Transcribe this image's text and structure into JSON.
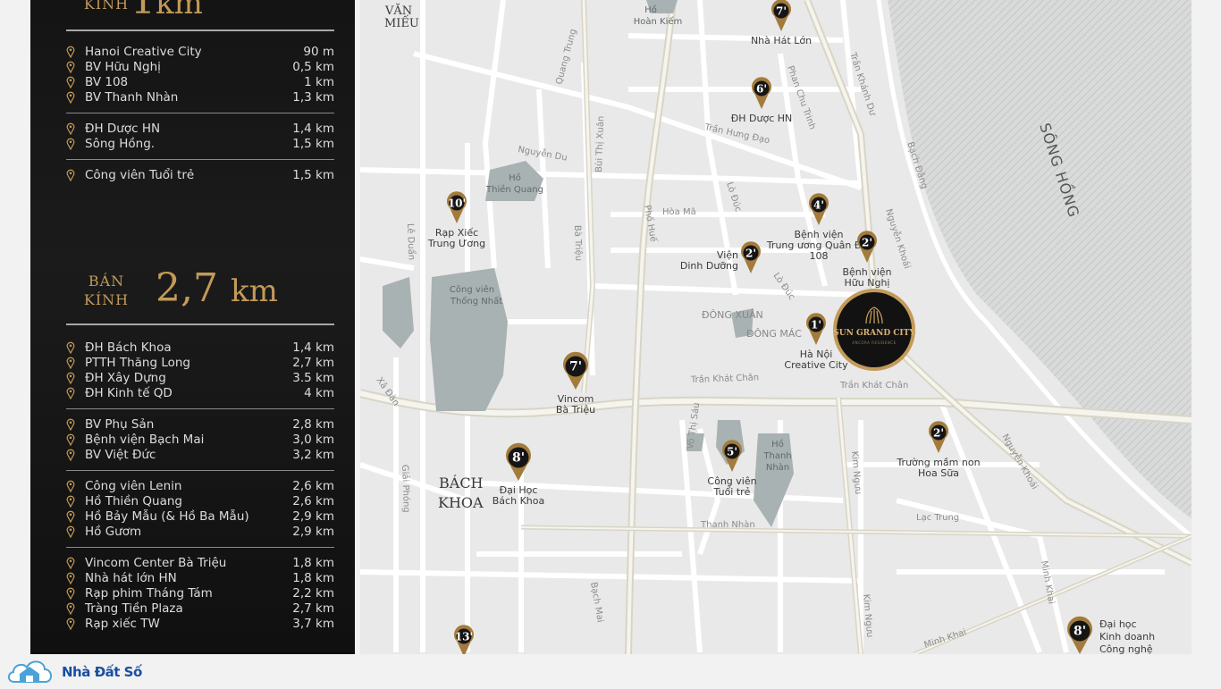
{
  "panel": {
    "top_heading": {
      "label": "KÍNH",
      "value": "1",
      "unit": "km"
    },
    "radius": {
      "line1": "BÁN",
      "line2": "KÍNH",
      "value": "2,7",
      "unit": "km"
    },
    "groups_1km": [
      [
        {
          "name": "Hanoi Creative City",
          "distance": "90 m"
        },
        {
          "name": "BV Hữu Nghị",
          "distance": "0,5 km"
        },
        {
          "name": "BV 108",
          "distance": "1 km"
        },
        {
          "name": "BV Thanh Nhàn",
          "distance": "1,3 km"
        }
      ],
      [
        {
          "name": "ĐH Dược HN",
          "distance": "1,4 km"
        },
        {
          "name": "Sông Hồng.",
          "distance": "1,5 km"
        }
      ],
      [
        {
          "name": "Công viên Tuổi trẻ",
          "distance": "1,5 km"
        }
      ]
    ],
    "groups_27km": [
      [
        {
          "name": "ĐH Bách Khoa",
          "distance": "1,4 km"
        },
        {
          "name": "PTTH Thăng Long",
          "distance": "2,7 km"
        },
        {
          "name": "ĐH Xây Dựng",
          "distance": "3.5 km"
        },
        {
          "name": "ĐH Kinh tế QD",
          "distance": "4 km"
        }
      ],
      [
        {
          "name": "BV Phụ Sản",
          "distance": "2,8 km"
        },
        {
          "name": "Bệnh viện Bạch Mai",
          "distance": "3,0 km"
        },
        {
          "name": "BV Việt Đức",
          "distance": "3,2 km"
        }
      ],
      [
        {
          "name": "Công viên Lenin",
          "distance": "2,6 km"
        },
        {
          "name": "Hồ Thiền Quang",
          "distance": "2,6 km"
        },
        {
          "name": "Hồ Bảy Mẫu (& Hồ Ba Mẫu)",
          "distance": "2,9 km"
        },
        {
          "name": "Hồ Gươm",
          "distance": "2,9 km"
        }
      ],
      [
        {
          "name": "Vincom Center Bà Triệu",
          "distance": "1,8 km"
        },
        {
          "name": "Nhà hát lớn HN",
          "distance": "1,8 km"
        },
        {
          "name": "Rạp phim Tháng Tám",
          "distance": "2,2 km"
        },
        {
          "name": "Tràng Tiền Plaza",
          "distance": "2,7 km"
        },
        {
          "name": "Rạp xiếc TW",
          "distance": "3,7 km"
        }
      ]
    ]
  },
  "map": {
    "center_logo": {
      "line1": "SUN GRAND CITY",
      "line2": "ANCORA RESIDENCE"
    },
    "river_label": "SÔNG HỒNG",
    "districts": {
      "van_mieu_1": "VĂN",
      "van_mieu_2": "MIẾU",
      "bach_khoa_1": "BÁCH",
      "bach_khoa_2": "KHOA"
    },
    "areas": {
      "dong_xuan": "ĐÔNG XUÂN",
      "dong_mac": "ĐÔNG MÁC"
    },
    "lakes": {
      "hoan_kiem_1": "Hồ",
      "hoan_kiem_2": "Hoàn Kiếm",
      "thien_quang_1": "Hồ",
      "thien_quang_2": "Thiền Quang",
      "thong_nhat_1": "Công viên",
      "thong_nhat_2": "Thống Nhất",
      "thanh_nhan_1": "Hồ",
      "thanh_nhan_2": "Thanh",
      "thanh_nhan_3": "Nhàn"
    },
    "roads": {
      "quang_trung": "Quang Trung",
      "phan_chu_trinh": "Phan Chu Trinh",
      "tran_khanh_du": "Trần Khánh Dư",
      "tran_hung_dao": "Trần Hưng Đạo",
      "bach_dang": "Bạch Đằng",
      "nguyen_du": "Nguyễn Du",
      "hoa_ma": "Hòa Mã",
      "lo_duc_1": "Lò Đúc",
      "lo_duc_2": "Lò Đúc",
      "pho_hue": "Phố Huế",
      "bui_thi_xuan": "Bùi Thị Xuân",
      "ba_trieu": "Bà Triệu",
      "le_duan": "Lê Duẩn",
      "nguyen_khoai_1": "Nguyễn Khoái",
      "nguyen_khoai_2": "Nguyễn Khoái",
      "tran_khat_chan_1": "Trần Khát Chân",
      "tran_khat_chan_2": "Trần Khát Chân",
      "xa_dan": "Xã Đàn",
      "giai_phong": "Giải Phóng",
      "vo_thi_sau": "Võ Thị Sáu",
      "kim_nguu_1": "Kim Ngưu",
      "kim_nguu_2": "Kim Ngưu",
      "thanh_nhan": "Thanh Nhàn",
      "lac_trung": "Lạc Trung",
      "minh_khai_1": "Minh Khai",
      "minh_khai_2": "Minh Khai",
      "bach_mai": "Bạch Mai"
    },
    "markers": [
      {
        "id": "nha-hat-lon",
        "num": "7",
        "label1": "Nhà Hát Lớn",
        "label2": ""
      },
      {
        "id": "dh-duoc",
        "num": "6",
        "label1": "ĐH Dược HN",
        "label2": ""
      },
      {
        "id": "rap-xiec",
        "num": "10",
        "label1": "Rạp Xiếc",
        "label2": "Trung Ương"
      },
      {
        "id": "bv-108",
        "num": "4",
        "label1": "Bệnh viện",
        "label2": "Trung ương Quân Đội",
        "label3": "108"
      },
      {
        "id": "vien-dinh-duong",
        "num": "2",
        "label1": "Viện",
        "label2": "Dinh Dưỡng"
      },
      {
        "id": "bv-huu-nghi",
        "num": "2",
        "label1": "Bệnh viện",
        "label2": "Hữu Nghị"
      },
      {
        "id": "creative-city",
        "num": "1",
        "label1": "Hà Nội",
        "label2": "Creative City"
      },
      {
        "id": "vincom",
        "num": "7",
        "label1": "Vincom",
        "label2": "Bà Triệu"
      },
      {
        "id": "dh-bach-khoa",
        "num": "8",
        "label1": "Đại Học",
        "label2": "Bách Khoa"
      },
      {
        "id": "cv-tuoi-tre",
        "num": "5",
        "label1": "Công viên",
        "label2": "Tuổi trẻ"
      },
      {
        "id": "mam-non",
        "num": "2",
        "label1": "Trường mầm non",
        "label2": "Hoa Sữa"
      },
      {
        "id": "marker-13",
        "num": "13",
        "label1": "",
        "label2": ""
      },
      {
        "id": "dh-kinh-doanh",
        "num": "8",
        "label1": "Đại học",
        "label2": "Kinh doanh",
        "label3": "Công nghệ"
      }
    ],
    "top_partial": {
      "hoan_kiem": "Hồ"
    }
  },
  "logo": {
    "brand": "Nhà Đất Số"
  },
  "colors": {
    "gold": "#c39a58",
    "marker_gold": "#a37b3c",
    "lake": "#a9b2b2",
    "road": "#ffffff",
    "major_road": "#d8d4c4",
    "panel": "#151515"
  }
}
